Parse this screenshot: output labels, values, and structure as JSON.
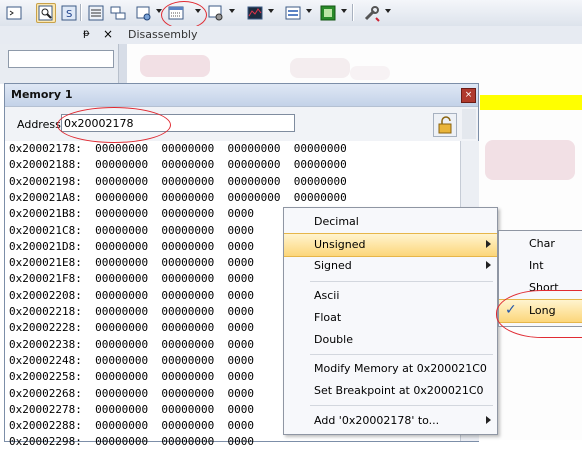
{
  "toolbar": {
    "buttons": [
      {
        "name": "command-window-button",
        "icon": "terminal-icon"
      },
      {
        "name": "disassembly-window-button",
        "icon": "magnify-page-icon",
        "pressed": true
      },
      {
        "name": "symbols-window-button",
        "icon": "symbols-icon"
      },
      {
        "name": "registers-window-button",
        "icon": "registers-icon"
      },
      {
        "name": "call-stack-button",
        "icon": "call-stack-icon"
      },
      {
        "name": "watch-window-button",
        "icon": "watch-icon"
      },
      {
        "name": "memory-window-button",
        "icon": "memory-icon"
      },
      {
        "name": "serial-window-button",
        "icon": "serial-icon"
      },
      {
        "name": "logic-analyzer-button",
        "icon": "analyzer-icon"
      },
      {
        "name": "system-viewer-button",
        "icon": "system-viewer-icon"
      },
      {
        "name": "trace-button",
        "icon": "trace-icon"
      },
      {
        "name": "toolbox-button",
        "icon": "wrench-icon"
      }
    ]
  },
  "panes": {
    "pin_glyph": "ᵽ",
    "close_glyph": "×",
    "disassembly_title": "Disassembly"
  },
  "memory_window": {
    "title": "Memory 1",
    "close_glyph": "×",
    "address_label": "Address:",
    "address_value": "0x20002178",
    "rows": [
      "0x20002178:  00000000  00000000  00000000  00000000",
      "0x20002188:  00000000  00000000  00000000  00000000",
      "0x20002198:  00000000  00000000  00000000  00000000",
      "0x200021A8:  00000000  00000000  00000000  00000000",
      "0x200021B8:  00000000  00000000  0000",
      "0x200021C8:  00000000  00000000  0000",
      "0x200021D8:  00000000  00000000  0000",
      "0x200021E8:  00000000  00000000  0000",
      "0x200021F8:  00000000  00000000  0000",
      "0x20002208:  00000000  00000000  0000",
      "0x20002218:  00000000  00000000  0000",
      "0x20002228:  00000000  00000000  0000",
      "0x20002238:  00000000  00000000  0000",
      "0x20002248:  00000000  00000000  0000",
      "0x20002258:  00000000  00000000  0000",
      "0x20002268:  00000000  00000000  0000",
      "0x20002278:  00000000  00000000  0000",
      "0x20002288:  00000000  00000000  0000",
      "0x20002298:  00000000  00000000  0000"
    ]
  },
  "context_menu": {
    "decimal": "Decimal",
    "unsigned": "Unsigned",
    "signed": "Signed",
    "ascii": "Ascii",
    "float": "Float",
    "double": "Double",
    "modify_memory": "Modify Memory at 0x200021C0",
    "set_breakpoint": "Set Breakpoint at 0x200021C0",
    "add_to": "Add '0x20002178' to..."
  },
  "submenu": {
    "char": "Char",
    "int": "Int",
    "short": "Short",
    "long": "Long",
    "check_glyph": "✓",
    "checked_item": "Long"
  },
  "colors": {
    "highlight": "#fcd67a",
    "annotation_ring": "#e02b33",
    "disasm_current_line": "#ffff00"
  }
}
